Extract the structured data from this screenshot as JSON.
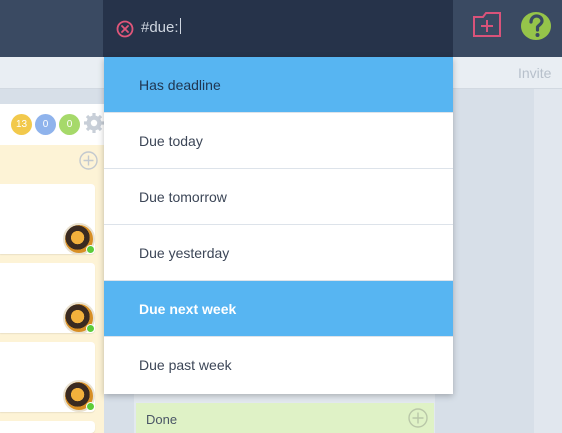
{
  "search": {
    "query": "#due:"
  },
  "dropdown": {
    "options": [
      {
        "label": "Has deadline"
      },
      {
        "label": "Due today"
      },
      {
        "label": "Due tomorrow"
      },
      {
        "label": "Due yesterday"
      },
      {
        "label": "Due next week"
      },
      {
        "label": "Due past week"
      }
    ]
  },
  "header": {
    "invite_label": "Invite"
  },
  "counters": {
    "yellow": "13",
    "blue": "0",
    "green": "0"
  },
  "board": {
    "done_label": "Done"
  },
  "colors": {
    "topbar": "#3a4a62",
    "search_bg": "#26334a",
    "highlight": "#57b5f2",
    "done_bg": "#dff2c6",
    "list_bg": "#fdf3d6"
  },
  "icons": [
    "clear-icon",
    "add-folder-icon",
    "help-icon",
    "gear-icon",
    "add-icon"
  ]
}
